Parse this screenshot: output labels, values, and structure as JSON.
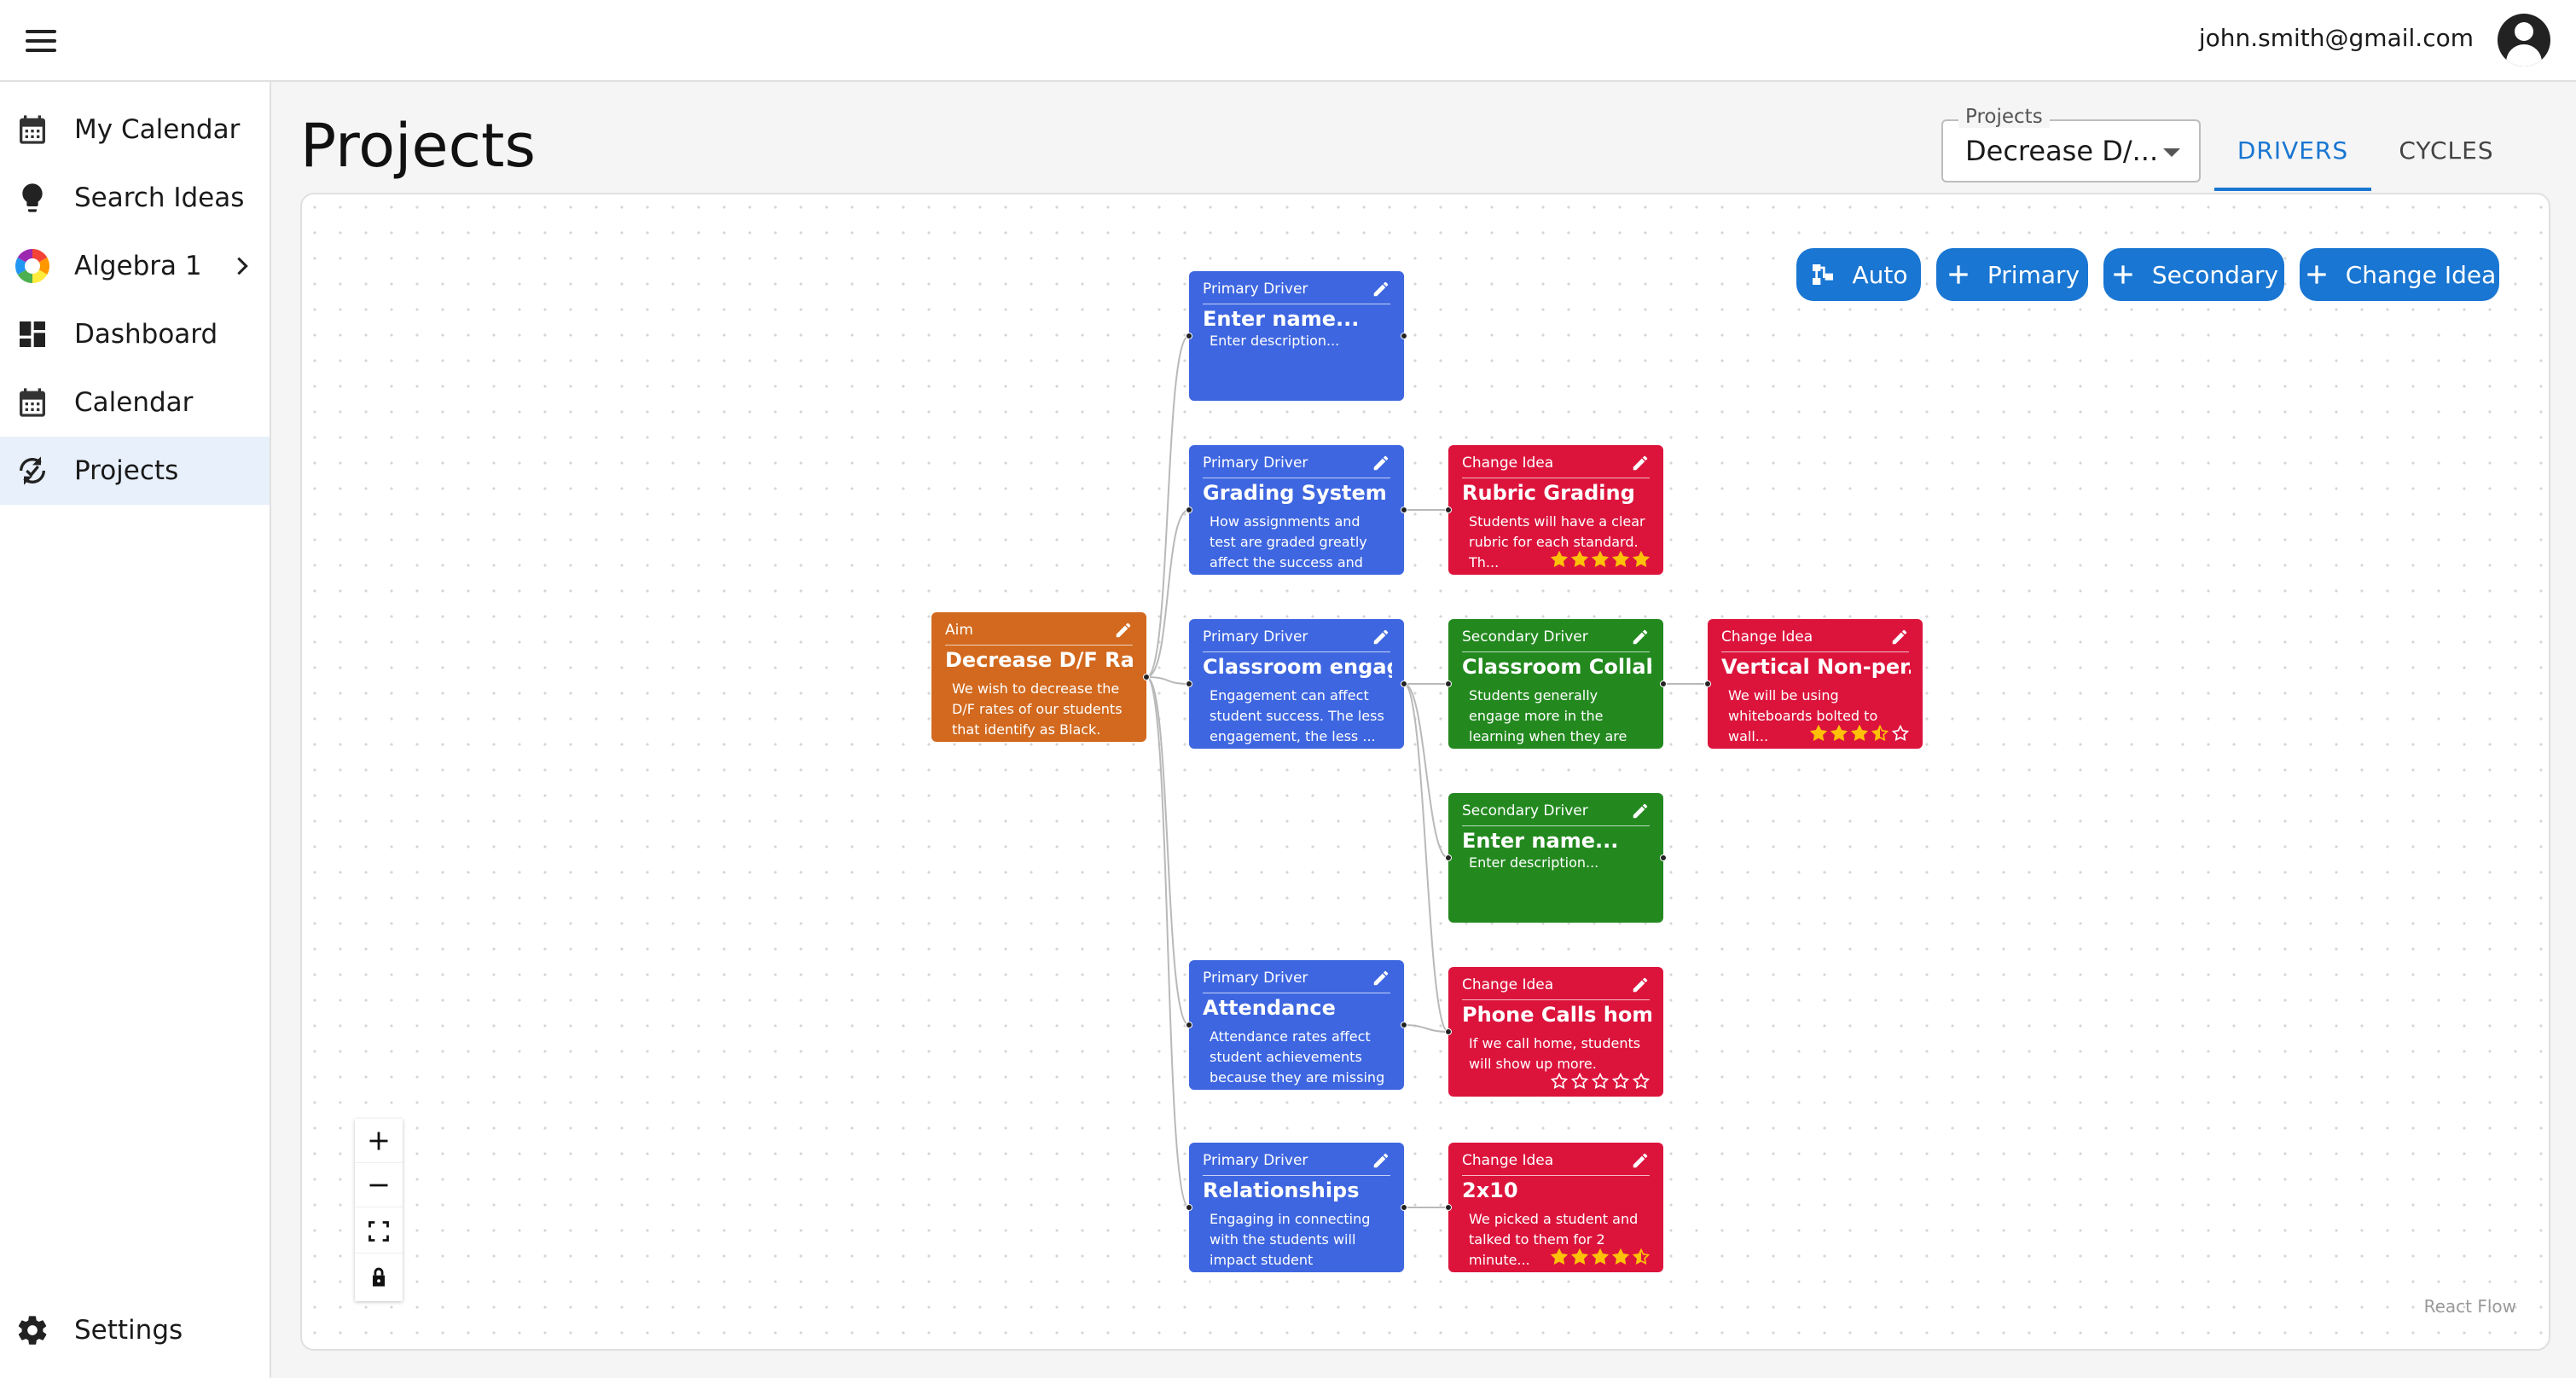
{
  "header": {
    "user_email": "john.smith@gmail.com"
  },
  "sidebar": {
    "items": [
      {
        "label": "My Calendar",
        "icon": "calendar-icon"
      },
      {
        "label": "Search Ideas",
        "icon": "lightbulb-icon"
      },
      {
        "label": "Algebra 1",
        "icon": "color-wheel-icon"
      },
      {
        "label": "Dashboard",
        "icon": "dashboard-icon"
      },
      {
        "label": "Calendar",
        "icon": "calendar-icon"
      },
      {
        "label": "Projects",
        "icon": "cycle-check-icon",
        "active": true
      }
    ],
    "settings_label": "Settings"
  },
  "main": {
    "title": "Projects",
    "project_select": {
      "legend": "Projects",
      "value": "Decrease D/..."
    },
    "tabs": [
      {
        "label": "DRIVERS",
        "active": true
      },
      {
        "label": "CYCLES",
        "active": false
      }
    ]
  },
  "toolbar": {
    "auto_label": "Auto",
    "primary_label": "Primary",
    "secondary_label": "Secondary",
    "change_idea_label": "Change Idea"
  },
  "colors": {
    "accent": "#1976d2",
    "aim": "#d2691e",
    "primary_driver": "#3e66e0",
    "secondary_driver": "#23891f",
    "change_idea": "#dc143c",
    "star": "#ffc107"
  },
  "watermark": "React Flow",
  "nodes": [
    {
      "type": "Aim",
      "name": "Decrease D/F Rat...",
      "desc": "We wish to decrease the D/F rates of our students that identify as Black."
    },
    {
      "type": "Primary Driver",
      "name": "Enter name...",
      "desc": "Enter description..."
    },
    {
      "type": "Primary Driver",
      "name": "Grading System",
      "desc": "How assignments and test are graded greatly affect the success and failures of ..."
    },
    {
      "type": "Primary Driver",
      "name": "Classroom engag...",
      "desc": "Engagement can affect student success. The less engagement, the less ..."
    },
    {
      "type": "Primary Driver",
      "name": "Attendance",
      "desc": "Attendance rates affect student achievements because they are missing ..."
    },
    {
      "type": "Primary Driver",
      "name": "Relationships",
      "desc": "Engaging in connecting with the students will impact student motivation to ..."
    },
    {
      "type": "Change Idea",
      "name": "Rubric Grading",
      "desc": "Students will have a clear rubric for each standard. Th...",
      "rating": 5
    },
    {
      "type": "Secondary Driver",
      "name": "Classroom Collab...",
      "desc": "Students generally engage more in the learning when they are willing to engage ..."
    },
    {
      "type": "Secondary Driver",
      "name": "Enter name...",
      "desc": "Enter description..."
    },
    {
      "type": "Change Idea",
      "name": "Phone Calls home",
      "desc": "If we call home, students will show up more.",
      "rating": 0
    },
    {
      "type": "Change Idea",
      "name": "2x10",
      "desc": "We picked a student and talked to them for 2 minute...",
      "rating": 4.5
    },
    {
      "type": "Change Idea",
      "name": "Vertical Non-per...",
      "desc": "We will be using whiteboards bolted to wall...",
      "rating": 3.5
    }
  ]
}
